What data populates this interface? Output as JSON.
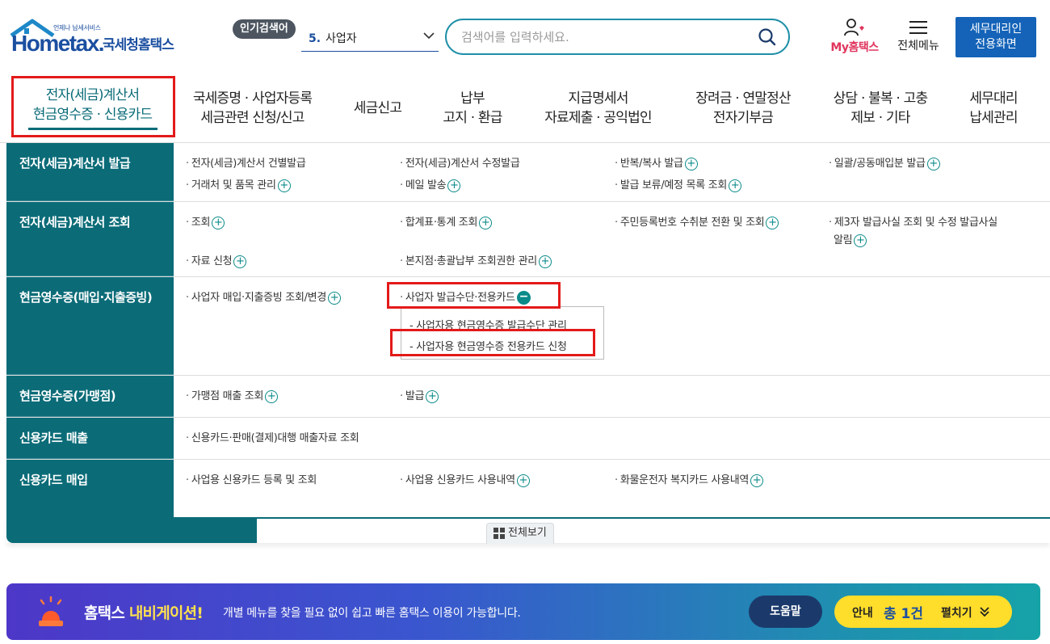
{
  "header": {
    "logo_sub": "언제나 납세서비스",
    "logo_brand": "Hometax.",
    "logo_kr": "국세청홈택스",
    "popular_badge": "인기검색어",
    "popular_num": "5.",
    "popular_value": "사업자",
    "search_placeholder": "검색어를 입력하세요.",
    "my_label": "My홈택스",
    "all_menu_label": "전체메뉴",
    "tax_agent_btn_line1": "세무대리인",
    "tax_agent_btn_line2": "전용화면"
  },
  "gnb": [
    {
      "line1": "전자(세금)계산서",
      "line2": "현금영수증 · 신용카드"
    },
    {
      "line1": "국세증명 · 사업자등록",
      "line2": "세금관련 신청/신고"
    },
    {
      "line1": "세금신고",
      "line2": ""
    },
    {
      "line1": "납부",
      "line2": "고지 · 환급"
    },
    {
      "line1": "지급명세서",
      "line2": "자료제출 · 공익법인"
    },
    {
      "line1": "장려금 · 연말정산",
      "line2": "전자기부금"
    },
    {
      "line1": "상담 · 불복 · 고충",
      "line2": "제보 · 기타"
    },
    {
      "line1": "세무대리",
      "line2": "납세관리"
    }
  ],
  "menu": {
    "cat1": "전자(세금)계산서 발급",
    "cat2": "전자(세금)계산서 조회",
    "cat3": "현금영수증(매입·지출증빙)",
    "cat4": "현금영수증(가맹점)",
    "cat5": "신용카드 매출",
    "cat6": "신용카드 매입",
    "r1": [
      "전자(세금)계산서 건별발급",
      "전자(세금)계산서 수정발급",
      "반복/복사 발급",
      "일괄/공동매입분 발급",
      "거래처 및 품목 관리",
      "메일 발송",
      "발급 보류/예정 목록 조회"
    ],
    "r2": [
      "조회",
      "합계표·통계 조회",
      "주민등록번호 수취분 전환 및 조회",
      "제3자 발급사실 조회 및 수정 발급사실",
      "알림",
      "자료 신청",
      "본지점·총괄납부 조회권한 관리"
    ],
    "r3": [
      "사업자 매입·지출증빙 조회/변경",
      "사업자 발급수단·전용카드"
    ],
    "r3_sub": [
      "사업자용 현금영수증 발급수단 관리",
      "사업자용 현금영수증 전용카드 신청"
    ],
    "r4": [
      "가맹점 매출 조회",
      "발급"
    ],
    "r5": [
      "신용카드·판매(결제)대행 매출자료 조회"
    ],
    "r6": [
      "사업용 신용카드 등록 및 조회",
      "사업용 신용카드 사용내역",
      "화물운전자 복지카드 사용내역"
    ],
    "view_all": "전체보기"
  },
  "banner": {
    "title_a": "홈택스 ",
    "title_b": "내비게이션!",
    "desc": "개별 메뉴를 찾을 필요 없이 쉽고 빠른 홈택스 이용이 가능합니다.",
    "help": "도움말",
    "guide": "안내",
    "count": "총 1건",
    "open": "펼치기"
  },
  "colors": {
    "teal": "#0b6c78",
    "highlight_red": "#e31a1a",
    "brand_blue": "#1b4fa0"
  }
}
